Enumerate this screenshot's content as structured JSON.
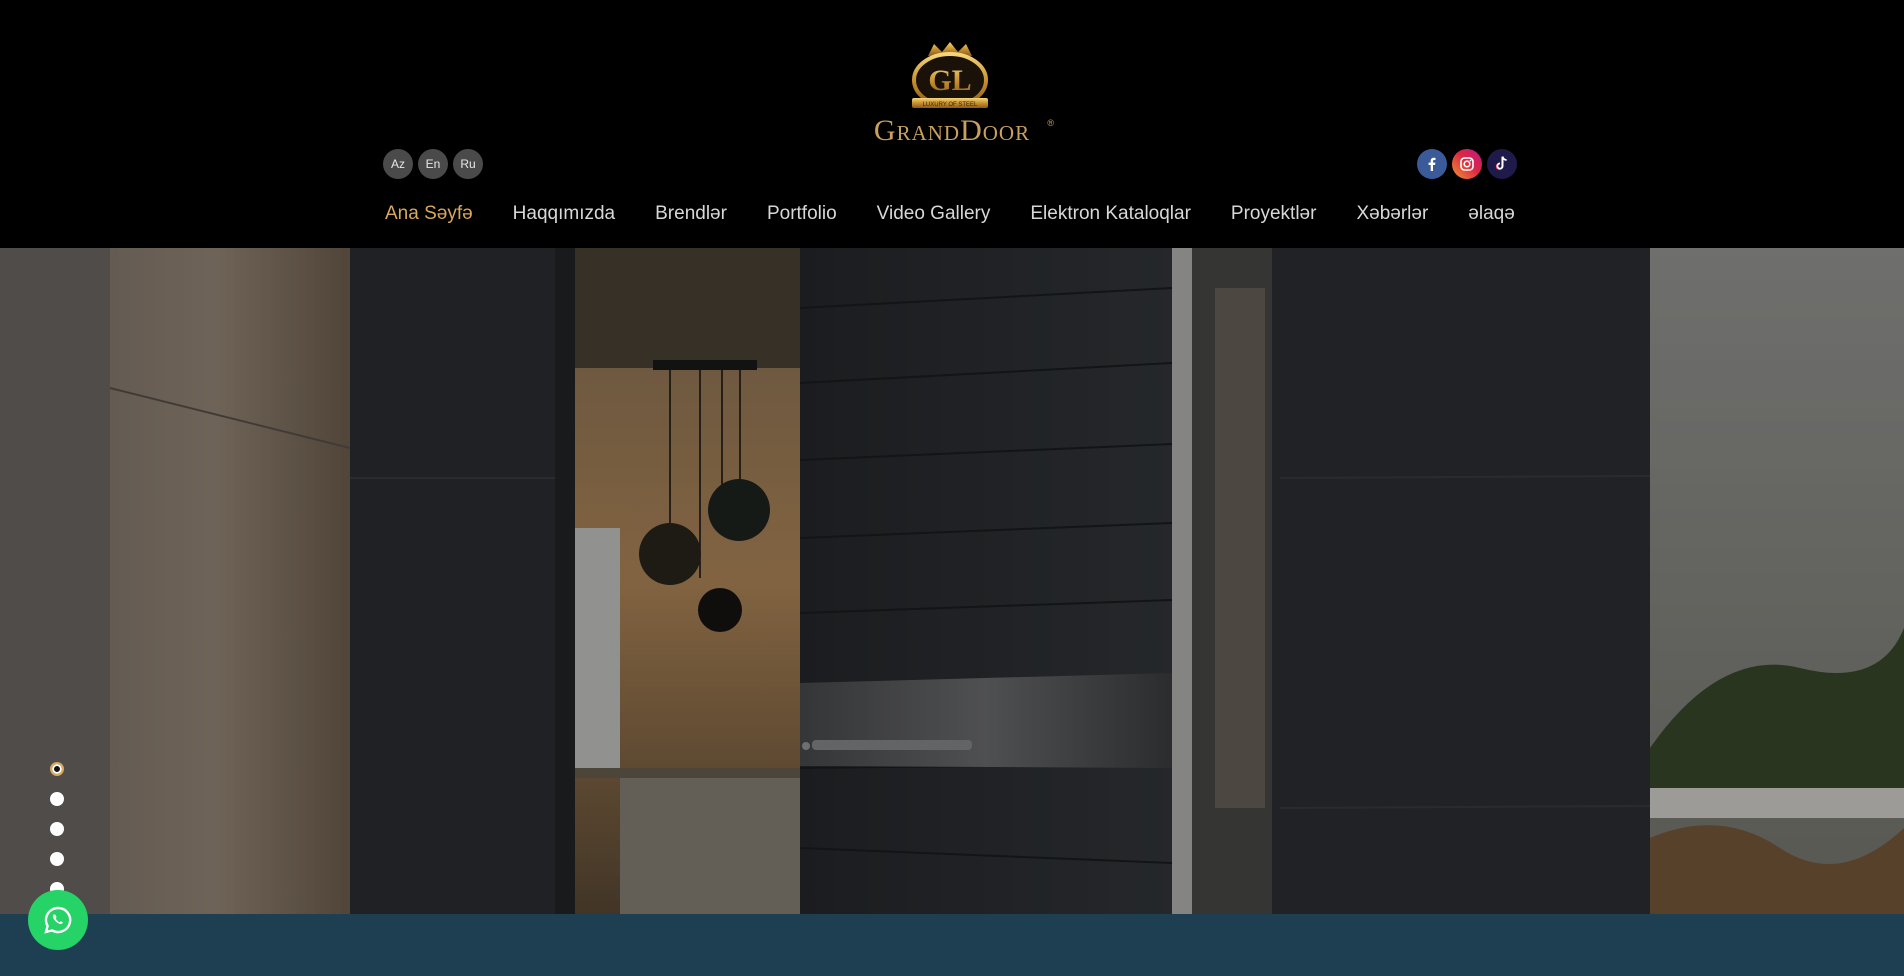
{
  "brand": {
    "logo_text": "GrandDoor",
    "reg_mark": "®",
    "emblem_tagline": "LUXURY OF STEEL",
    "gold": "#c9a060"
  },
  "languages": [
    "Az",
    "En",
    "Ru"
  ],
  "social": [
    {
      "name": "facebook",
      "icon": "facebook-icon"
    },
    {
      "name": "instagram",
      "icon": "instagram-icon"
    },
    {
      "name": "tiktok",
      "icon": "tiktok-icon"
    }
  ],
  "nav": {
    "items": [
      "Ana Səyfə",
      "Haqqımızda",
      "Brendlər",
      "Portfolio",
      "Video Gallery",
      "Elektron Kataloqlar",
      "Proyektlər",
      "Xəbərlər",
      "əlaqə"
    ],
    "active_index": 0,
    "active_color": "#d9a85b"
  },
  "slider": {
    "slide_count": 5,
    "active_slide": 1
  },
  "colors": {
    "header_bg": "#000000",
    "band": "#1e3e52",
    "whatsapp": "#25d366"
  },
  "whatsapp": {
    "icon": "whatsapp-icon"
  }
}
